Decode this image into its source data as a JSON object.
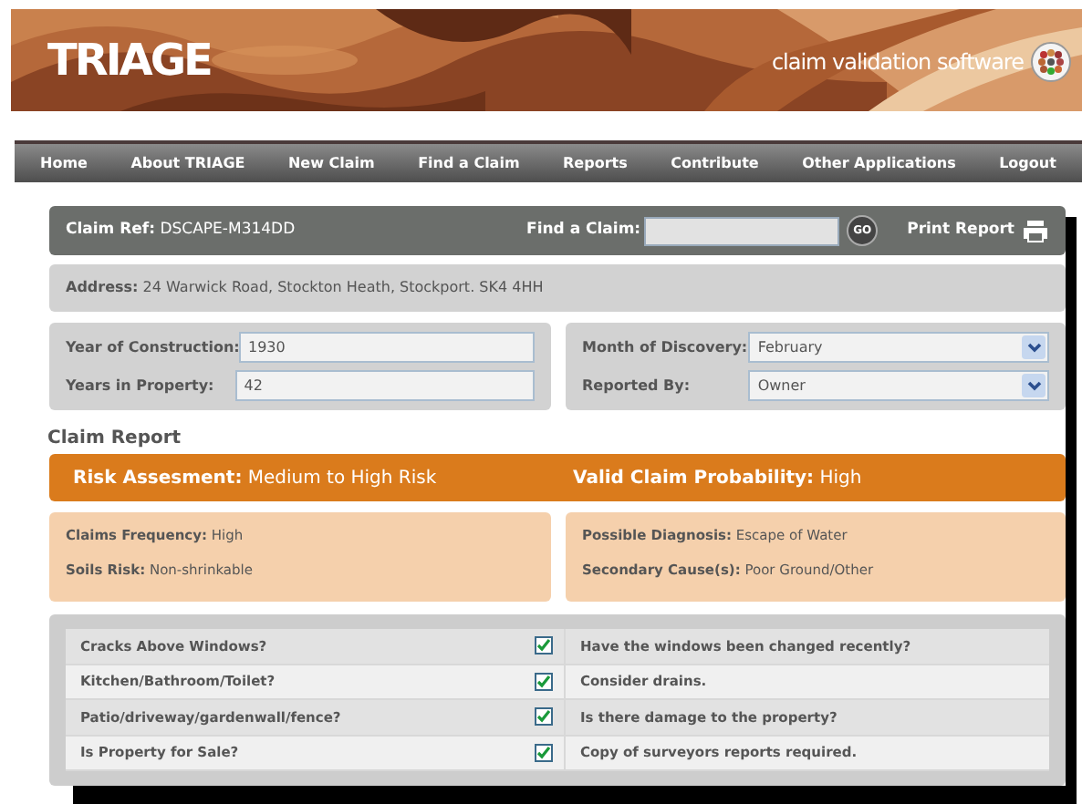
{
  "header": {
    "logo": "TRIAGE",
    "tagline": "claim validation software"
  },
  "nav": [
    "Home",
    "About TRIAGE",
    "New Claim",
    "Find a Claim",
    "Reports",
    "Contribute",
    "Other Applications",
    "Logout"
  ],
  "claim_bar": {
    "ref_label": "Claim Ref:",
    "ref_value": "DSCAPE-M314DD",
    "find_label": "Find a Claim:",
    "go": "GO",
    "print": "Print Report"
  },
  "address": {
    "label": "Address:",
    "value": "24 Warwick Road, Stockton Heath, Stockport. SK4 4HH"
  },
  "fields_left": [
    {
      "label": "Year of Construction:",
      "value": "1930"
    },
    {
      "label": "Years in Property:",
      "value": "42"
    }
  ],
  "fields_right": [
    {
      "label": "Month of Discovery:",
      "value": "February"
    },
    {
      "label": "Reported By:",
      "value": "Owner"
    }
  ],
  "report_title": "Claim Report",
  "risk": [
    {
      "label": "Risk Assesment:",
      "value": "Medium to High Risk"
    },
    {
      "label": "Valid Claim Probability:",
      "value": "High"
    }
  ],
  "details_left": [
    {
      "label": "Claims Frequency:",
      "value": "High"
    },
    {
      "label": "Soils Risk:",
      "value": "Non-shrinkable"
    }
  ],
  "details_right": [
    {
      "label": "Possible Diagnosis:",
      "value": "Escape of Water"
    },
    {
      "label": "Secondary Cause(s):",
      "value": "Poor Ground/Other"
    }
  ],
  "checklist": [
    {
      "question": "Cracks Above Windows?",
      "checked": true,
      "advice": "Have the windows been changed recently?"
    },
    {
      "question": "Kitchen/Bathroom/Toilet?",
      "checked": true,
      "advice": "Consider drains."
    },
    {
      "question": "Patio/driveway/gardenwall/fence?",
      "checked": true,
      "advice": "Is there damage to the property?"
    },
    {
      "question": "Is Property for Sale?",
      "checked": true,
      "advice": "Copy of surveyors reports required."
    }
  ]
}
